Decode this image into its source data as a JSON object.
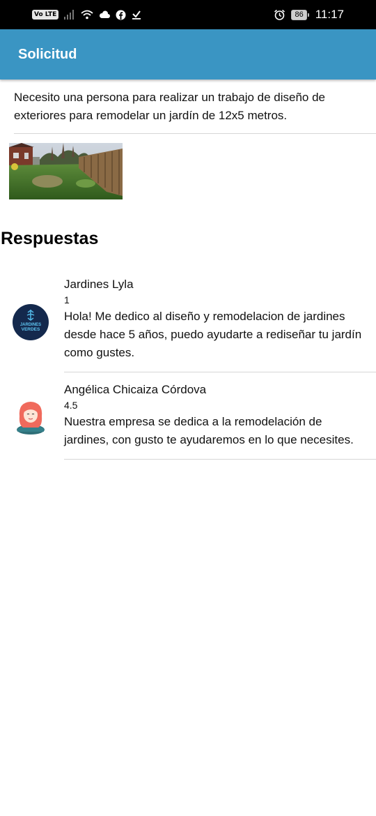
{
  "status_bar": {
    "volte_label": "Vo LTE",
    "battery_level": "86",
    "time": "11:17",
    "left_icons": [
      "signal-icon",
      "wifi-icon",
      "cloud-icon",
      "facebook-icon",
      "download-icon"
    ],
    "right_icons": [
      "alarm-icon",
      "battery-icon"
    ]
  },
  "app_bar": {
    "title": "Solicitud"
  },
  "request": {
    "description": "Necesito una persona para realizar un trabajo de diseño de exteriores para remodelar un jardín de 12x5 metros.",
    "photo_icon": "garden-photo"
  },
  "responses_section": {
    "title": "Respuestas",
    "items": [
      {
        "name": "Jardines Lyla",
        "rating": "1",
        "message": "Hola! Me dedico al diseño y remodelacion de jardines desde hace 5 años, puedo ayudarte a rediseñar tu jardín como gustes.",
        "avatar_text_1": "JARDINES",
        "avatar_text_2": "VERDES",
        "avatar_color": "#14294d"
      },
      {
        "name": "Angélica Chicaiza Córdova",
        "rating": "4.5",
        "message": "Nuestra empresa se dedica a la remodelación de jardines, con gusto te ayudaremos en lo que necesites.",
        "avatar_color": "#f06a5c"
      }
    ]
  },
  "colors": {
    "app_bar": "#3a95c3",
    "divider": "#d6d6d6"
  }
}
